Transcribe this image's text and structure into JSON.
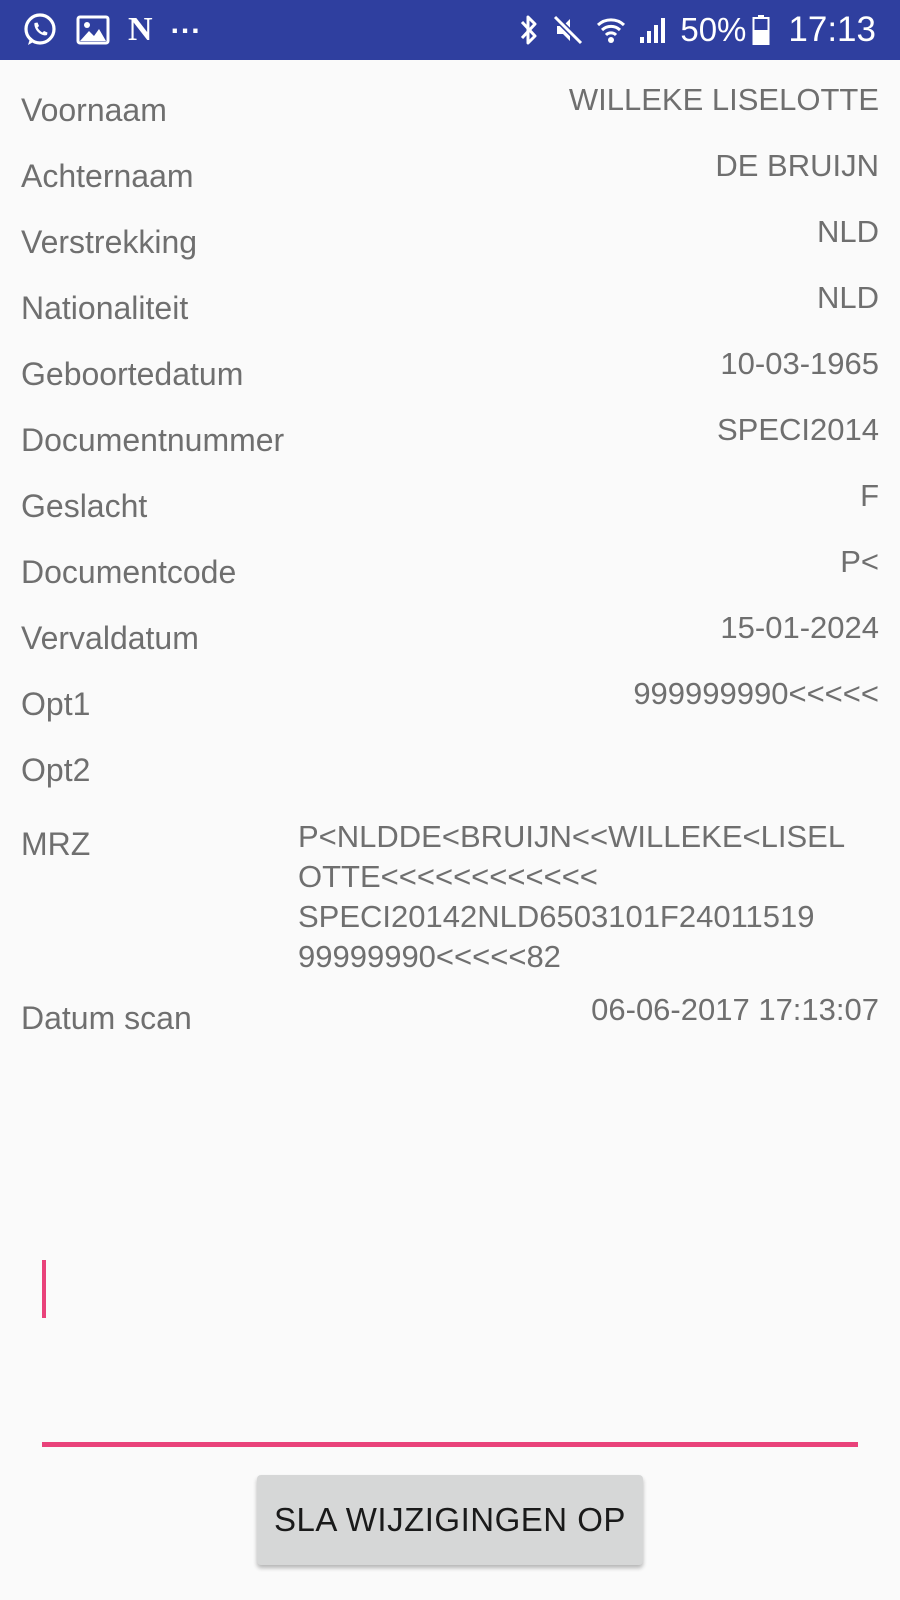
{
  "status_bar": {
    "left_icons": [
      "whatsapp-icon",
      "gallery-icon",
      "n-app-icon"
    ],
    "n_app_glyph": "N",
    "more_indicator": "...",
    "right_icons": [
      "bluetooth-icon",
      "mute-icon",
      "wifi-icon",
      "signal-icon",
      "battery-icon"
    ],
    "battery_percent": "50%",
    "time": "17:13",
    "background_color": "#2f3f9f"
  },
  "fields": [
    {
      "label": "Voornaam",
      "value": "WILLEKE LISELOTTE"
    },
    {
      "label": "Achternaam",
      "value": "DE BRUIJN"
    },
    {
      "label": "Verstrekking",
      "value": "NLD"
    },
    {
      "label": "Nationaliteit",
      "value": "NLD"
    },
    {
      "label": "Geboortedatum",
      "value": "10-03-1965"
    },
    {
      "label": "Documentnummer",
      "value": "SPECI2014"
    },
    {
      "label": "Geslacht",
      "value": "F"
    },
    {
      "label": "Documentcode",
      "value": "P<"
    },
    {
      "label": "Vervaldatum",
      "value": "15-01-2024"
    },
    {
      "label": "Opt1",
      "value": "999999990<<<<<"
    },
    {
      "label": "Opt2",
      "value": ""
    }
  ],
  "mrz": {
    "label": "MRZ",
    "lines": [
      "P<NLDDE<BRUIJN<<WILLEKE<LISEL",
      "OTTE<<<<<<<<<<<<",
      "SPECI20142NLD6503101F24011519",
      "99999990<<<<<82"
    ]
  },
  "scan_date": {
    "label": "Datum scan",
    "value": "06-06-2017 17:13:07"
  },
  "notes_input": {
    "value": "",
    "accent_color": "#e9427a"
  },
  "save_button": {
    "label": "SLA WIJZIGINGEN OP"
  }
}
